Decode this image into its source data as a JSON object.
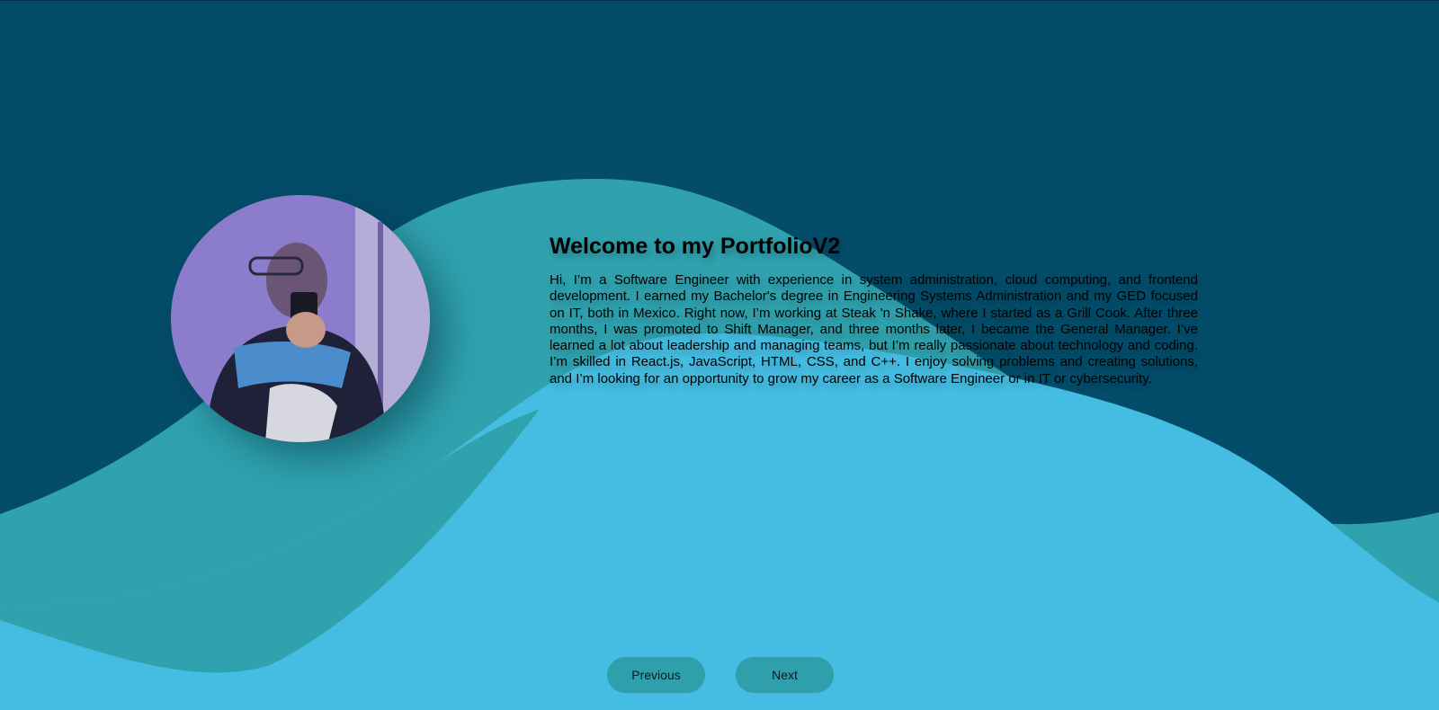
{
  "colors": {
    "background_top": "#044d6a",
    "wave_teal": "#2fa2ae",
    "wave_light": "#45bde2",
    "button_bg": "#2e9fab"
  },
  "hero": {
    "title": "Welcome to my PortfolioV2",
    "body": "Hi, I’m a Software Engineer with experience in system administration, cloud computing, and frontend development. I earned my Bachelor's degree in Engineering Systems Administration and my GED focused on IT, both in Mexico. Right now, I’m working at Steak 'n Shake, where I started as a Grill Cook. After three months, I was promoted to Shift Manager, and three months later, I became the General Manager. I’ve learned a lot about leadership and managing teams, but I’m really passionate about technology and coding. I’m skilled in React.js, JavaScript, HTML, CSS, and C++. I enjoy solving problems and creating solutions, and I’m looking for an opportunity to grow my career as a Software Engineer or in IT or cybersecurity."
  },
  "navigation": {
    "previous_label": "Previous",
    "next_label": "Next"
  }
}
